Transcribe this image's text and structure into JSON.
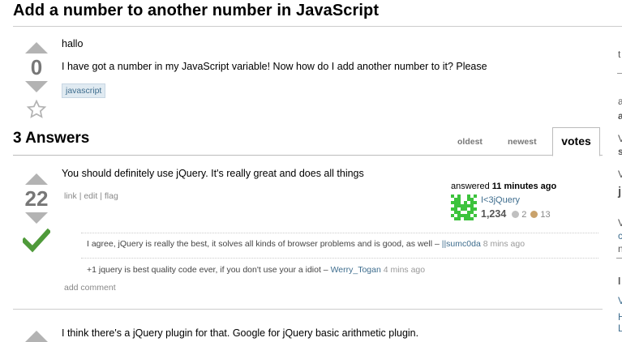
{
  "question": {
    "title": "Add a number to another number in JavaScript",
    "votes": "0",
    "body_line1": "hallo",
    "body_line2": "I have got a number in my JavaScript variable! Now how do I add another number to it? Please",
    "tag": "javascript"
  },
  "answers_header": {
    "count_label": "3 Answers",
    "tabs": [
      "oldest",
      "newest",
      "votes"
    ]
  },
  "answer1": {
    "votes": "22",
    "text": "You should definitely use jQuery. It's really great and does all things",
    "links": [
      "link",
      "edit",
      "flag"
    ],
    "answered_label": "answered",
    "answered_time": "11 minutes ago",
    "user": "I<3jQuery",
    "rep": "1,234",
    "silver": "2",
    "bronze": "13",
    "comments": [
      {
        "text": "I agree, jQuery is really the best, it solves all kinds of browser problems and is good, as well – ",
        "user": "||sumc0da",
        "time": "8 mins ago"
      },
      {
        "text": "+1 jquery is best quality code ever, if you don't use your a idiot – ",
        "user": "Werry_Togan",
        "time": "4 mins ago"
      }
    ],
    "add_comment": "add comment"
  },
  "answer2": {
    "text": "I think there's a jQuery plugin for that. Google for jQuery basic arithmetic plugin."
  },
  "sidebar": {
    "frags": [
      "t",
      "a",
      "a",
      "V",
      "s",
      "V",
      "j",
      "V",
      "c",
      "n",
      "l",
      "V",
      "H",
      "L"
    ]
  },
  "colors": {
    "accent": "#3e6d8e",
    "accepted": "#4f9a3a",
    "vote_arrow": "#b3b3b3"
  }
}
